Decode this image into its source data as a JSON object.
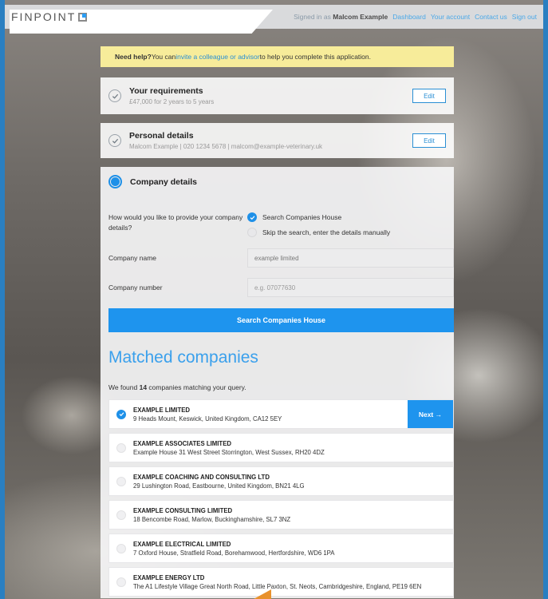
{
  "header": {
    "logo": "FINPOINT",
    "signed_in_prefix": "Signed in as",
    "user_name": "Malcom Example",
    "nav": [
      "Dashboard",
      "Your account",
      "Contact us",
      "Sign out"
    ]
  },
  "help": {
    "bold": "Need help?",
    "pre": " You can ",
    "link": "invite a colleague or advisor",
    "post": " to help you complete this application."
  },
  "steps": [
    {
      "title": "Your requirements",
      "subtitle": "£47,000 for 2 years to 5 years",
      "edit": "Edit"
    },
    {
      "title": "Personal details",
      "subtitle": "Malcom Example  |  020 1234 5678  |  malcom@example-veterinary.uk",
      "edit": "Edit"
    }
  ],
  "company": {
    "title": "Company details",
    "question": "How would you like to provide your company details?",
    "options": [
      "Search Companies House",
      "Skip the search, enter the details manually"
    ],
    "name_label": "Company name",
    "name_value": "example limited",
    "number_label": "Company number",
    "number_placeholder": "e.g. 07077630",
    "search_button": "Search Companies House"
  },
  "matched": {
    "title": "Matched companies",
    "found_pre": "We found ",
    "count": "14",
    "found_post": " companies matching your query.",
    "next_button": "Next →",
    "results": [
      {
        "name": "EXAMPLE LIMITED",
        "address": "9 Heads Mount, Keswick, United Kingdom, CA12 5EY",
        "selected": true
      },
      {
        "name": "EXAMPLE ASSOCIATES LIMITED",
        "address": "Example House 31 West Street Storrington, West Sussex, RH20 4DZ",
        "selected": false
      },
      {
        "name": "EXAMPLE COACHING AND CONSULTING LTD",
        "address": "29 Lushington Road, Eastbourne, United Kingdom, BN21 4LG",
        "selected": false
      },
      {
        "name": "EXAMPLE CONSULTING LIMITED",
        "address": "18 Bencombe Road, Marlow, Buckinghamshire, SL7 3NZ",
        "selected": false
      },
      {
        "name": "EXAMPLE ELECTRICAL LIMITED",
        "address": "7 Oxford House, Stratfield Road, Borehamwood, Hertfordshire, WD6 1PA",
        "selected": false
      },
      {
        "name": "EXAMPLE ENERGY LTD",
        "address": "The A1 Lifestyle Village Great North Road, Little Paxton, St. Neots, Cambridgeshire, England, PE19 6EN",
        "selected": false
      }
    ]
  },
  "colors": {
    "accent": "#1e94ee",
    "help_bg": "#f7ec9a",
    "frame": "#2a7fc1"
  }
}
